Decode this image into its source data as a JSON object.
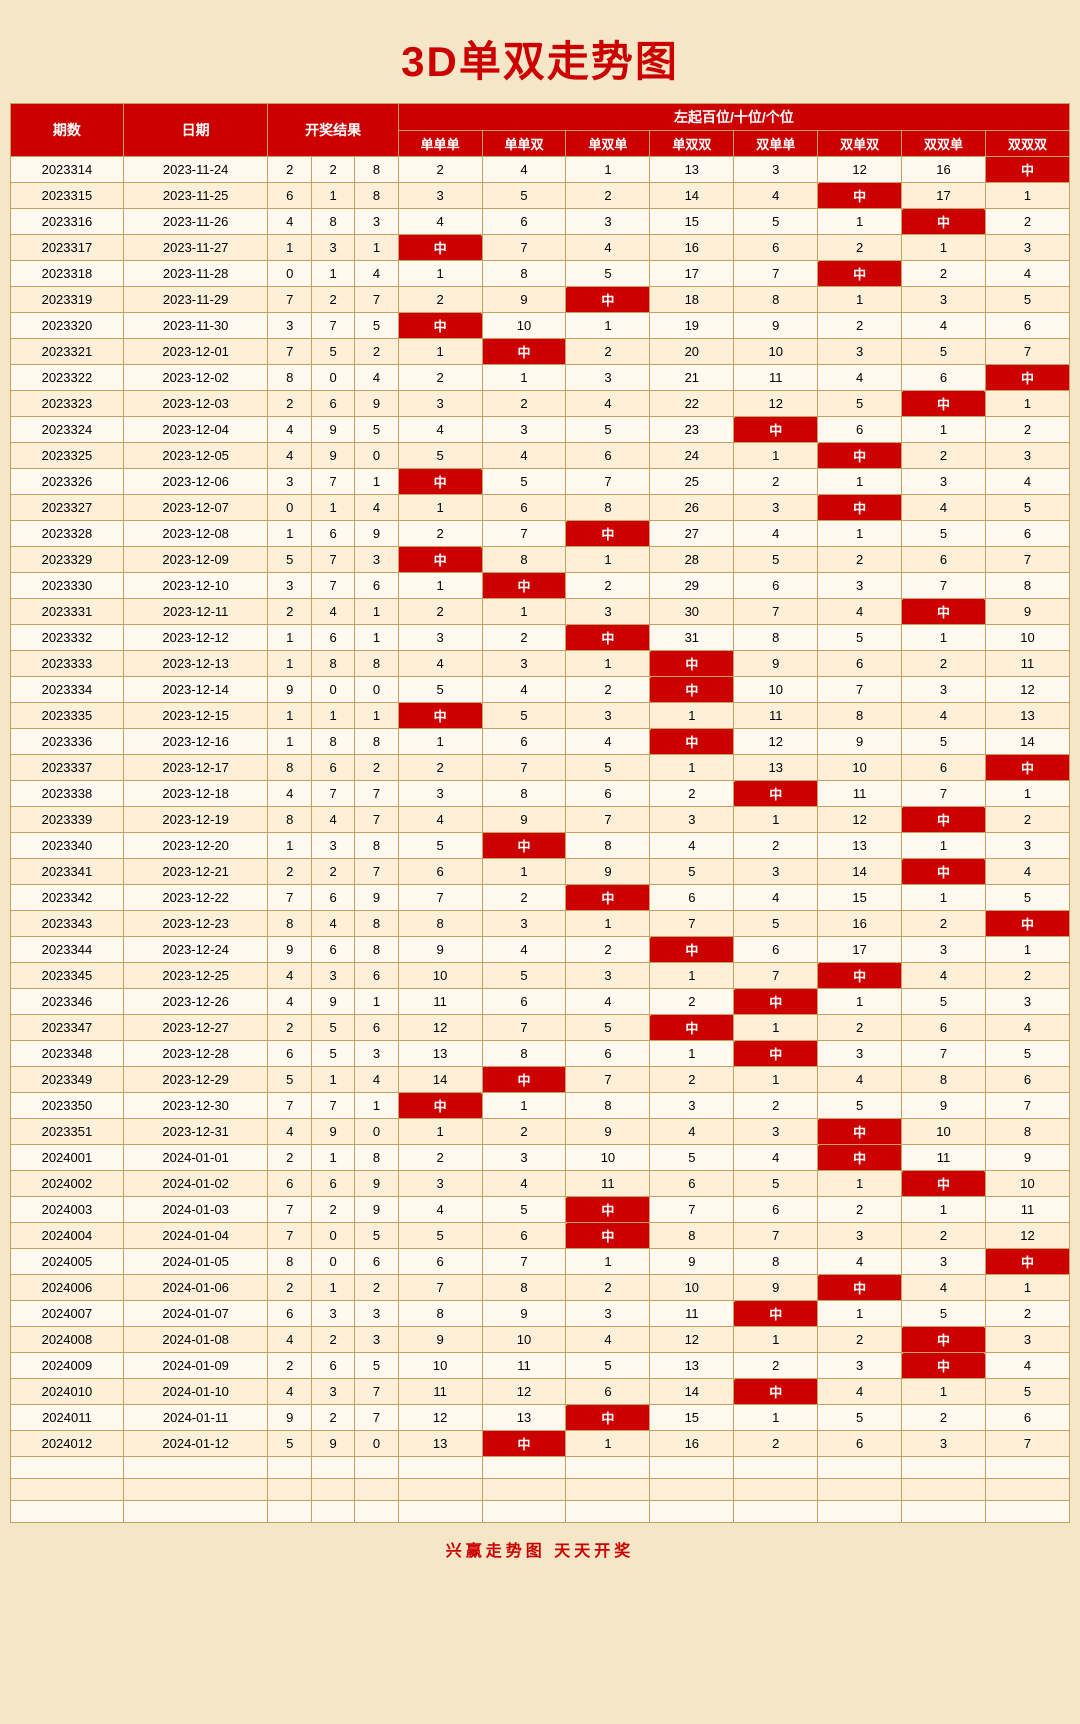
{
  "title": "3D单双走势图",
  "footer": "兴赢走势图   天天开奖",
  "headers": {
    "qishu": "期数",
    "date": "日期",
    "result": "开奖结果",
    "top_label": "左起百位/十位/个位",
    "cols": [
      "单单单",
      "单单双",
      "单双单",
      "单双双",
      "双单单",
      "双单双",
      "双双单",
      "双双双"
    ]
  },
  "rows": [
    {
      "id": "2023314",
      "date": "2023-11-24",
      "r": [
        2,
        2,
        8
      ],
      "vals": [
        2,
        4,
        1,
        13,
        3,
        12,
        16,
        "中"
      ]
    },
    {
      "id": "2023315",
      "date": "2023-11-25",
      "r": [
        6,
        1,
        8
      ],
      "vals": [
        3,
        5,
        2,
        14,
        4,
        "中",
        17,
        1
      ]
    },
    {
      "id": "2023316",
      "date": "2023-11-26",
      "r": [
        4,
        8,
        3
      ],
      "vals": [
        4,
        6,
        3,
        15,
        5,
        1,
        "中",
        2
      ]
    },
    {
      "id": "2023317",
      "date": "2023-11-27",
      "r": [
        1,
        3,
        1
      ],
      "vals": [
        "中",
        7,
        4,
        16,
        6,
        2,
        1,
        3
      ]
    },
    {
      "id": "2023318",
      "date": "2023-11-28",
      "r": [
        0,
        1,
        4
      ],
      "vals": [
        1,
        8,
        5,
        17,
        7,
        "中",
        2,
        4
      ]
    },
    {
      "id": "2023319",
      "date": "2023-11-29",
      "r": [
        7,
        2,
        7
      ],
      "vals": [
        2,
        9,
        "中",
        18,
        8,
        1,
        3,
        5
      ]
    },
    {
      "id": "2023320",
      "date": "2023-11-30",
      "r": [
        3,
        7,
        5
      ],
      "vals": [
        "中",
        10,
        1,
        19,
        9,
        2,
        4,
        6
      ]
    },
    {
      "id": "2023321",
      "date": "2023-12-01",
      "r": [
        7,
        5,
        2
      ],
      "vals": [
        1,
        "中",
        2,
        20,
        10,
        3,
        5,
        7
      ]
    },
    {
      "id": "2023322",
      "date": "2023-12-02",
      "r": [
        8,
        0,
        4
      ],
      "vals": [
        2,
        1,
        3,
        21,
        11,
        4,
        6,
        "中"
      ]
    },
    {
      "id": "2023323",
      "date": "2023-12-03",
      "r": [
        2,
        6,
        9
      ],
      "vals": [
        3,
        2,
        4,
        22,
        12,
        5,
        "中",
        1
      ]
    },
    {
      "id": "2023324",
      "date": "2023-12-04",
      "r": [
        4,
        9,
        5
      ],
      "vals": [
        4,
        3,
        5,
        23,
        "中",
        6,
        1,
        2
      ]
    },
    {
      "id": "2023325",
      "date": "2023-12-05",
      "r": [
        4,
        9,
        0
      ],
      "vals": [
        5,
        4,
        6,
        24,
        1,
        "中",
        2,
        3
      ]
    },
    {
      "id": "2023326",
      "date": "2023-12-06",
      "r": [
        3,
        7,
        1
      ],
      "vals": [
        "中",
        5,
        7,
        25,
        2,
        1,
        3,
        4
      ]
    },
    {
      "id": "2023327",
      "date": "2023-12-07",
      "r": [
        0,
        1,
        4
      ],
      "vals": [
        1,
        6,
        8,
        26,
        3,
        "中",
        4,
        5
      ]
    },
    {
      "id": "2023328",
      "date": "2023-12-08",
      "r": [
        1,
        6,
        9
      ],
      "vals": [
        2,
        7,
        "中",
        27,
        4,
        1,
        5,
        6
      ]
    },
    {
      "id": "2023329",
      "date": "2023-12-09",
      "r": [
        5,
        7,
        3
      ],
      "vals": [
        "中",
        8,
        1,
        28,
        5,
        2,
        6,
        7
      ]
    },
    {
      "id": "2023330",
      "date": "2023-12-10",
      "r": [
        3,
        7,
        6
      ],
      "vals": [
        1,
        "中",
        2,
        29,
        6,
        3,
        7,
        8
      ]
    },
    {
      "id": "2023331",
      "date": "2023-12-11",
      "r": [
        2,
        4,
        1
      ],
      "vals": [
        2,
        1,
        3,
        30,
        7,
        4,
        "中",
        9
      ]
    },
    {
      "id": "2023332",
      "date": "2023-12-12",
      "r": [
        1,
        6,
        1
      ],
      "vals": [
        3,
        2,
        "中",
        31,
        8,
        5,
        1,
        10
      ]
    },
    {
      "id": "2023333",
      "date": "2023-12-13",
      "r": [
        1,
        8,
        8
      ],
      "vals": [
        4,
        3,
        1,
        "中",
        9,
        6,
        2,
        11
      ]
    },
    {
      "id": "2023334",
      "date": "2023-12-14",
      "r": [
        9,
        0,
        0
      ],
      "vals": [
        5,
        4,
        2,
        "中",
        10,
        7,
        3,
        12
      ]
    },
    {
      "id": "2023335",
      "date": "2023-12-15",
      "r": [
        1,
        1,
        1
      ],
      "vals": [
        "中",
        5,
        3,
        1,
        11,
        8,
        4,
        13
      ]
    },
    {
      "id": "2023336",
      "date": "2023-12-16",
      "r": [
        1,
        8,
        8
      ],
      "vals": [
        1,
        6,
        4,
        "中",
        12,
        9,
        5,
        14
      ]
    },
    {
      "id": "2023337",
      "date": "2023-12-17",
      "r": [
        8,
        6,
        2
      ],
      "vals": [
        2,
        7,
        5,
        1,
        13,
        10,
        6,
        "中"
      ]
    },
    {
      "id": "2023338",
      "date": "2023-12-18",
      "r": [
        4,
        7,
        7
      ],
      "vals": [
        3,
        8,
        6,
        2,
        "中",
        11,
        7,
        1
      ]
    },
    {
      "id": "2023339",
      "date": "2023-12-19",
      "r": [
        8,
        4,
        7
      ],
      "vals": [
        4,
        9,
        7,
        3,
        1,
        12,
        "中",
        2
      ]
    },
    {
      "id": "2023340",
      "date": "2023-12-20",
      "r": [
        1,
        3,
        8
      ],
      "vals": [
        5,
        "中",
        8,
        4,
        2,
        13,
        1,
        3
      ]
    },
    {
      "id": "2023341",
      "date": "2023-12-21",
      "r": [
        2,
        2,
        7
      ],
      "vals": [
        6,
        1,
        9,
        5,
        3,
        14,
        "中",
        4
      ]
    },
    {
      "id": "2023342",
      "date": "2023-12-22",
      "r": [
        7,
        6,
        9
      ],
      "vals": [
        7,
        2,
        "中",
        6,
        4,
        15,
        1,
        5
      ]
    },
    {
      "id": "2023343",
      "date": "2023-12-23",
      "r": [
        8,
        4,
        8
      ],
      "vals": [
        8,
        3,
        1,
        7,
        5,
        16,
        2,
        "中"
      ]
    },
    {
      "id": "2023344",
      "date": "2023-12-24",
      "r": [
        9,
        6,
        8
      ],
      "vals": [
        9,
        4,
        2,
        "中",
        6,
        17,
        3,
        1
      ]
    },
    {
      "id": "2023345",
      "date": "2023-12-25",
      "r": [
        4,
        3,
        6
      ],
      "vals": [
        10,
        5,
        3,
        1,
        7,
        "中",
        4,
        2
      ]
    },
    {
      "id": "2023346",
      "date": "2023-12-26",
      "r": [
        4,
        9,
        1
      ],
      "vals": [
        11,
        6,
        4,
        2,
        "中",
        1,
        5,
        3
      ]
    },
    {
      "id": "2023347",
      "date": "2023-12-27",
      "r": [
        2,
        5,
        6
      ],
      "vals": [
        12,
        7,
        5,
        "中",
        1,
        2,
        6,
        4
      ]
    },
    {
      "id": "2023348",
      "date": "2023-12-28",
      "r": [
        6,
        5,
        3
      ],
      "vals": [
        13,
        8,
        6,
        1,
        "中",
        3,
        7,
        5
      ]
    },
    {
      "id": "2023349",
      "date": "2023-12-29",
      "r": [
        5,
        1,
        4
      ],
      "vals": [
        14,
        "中",
        7,
        2,
        1,
        4,
        8,
        6
      ]
    },
    {
      "id": "2023350",
      "date": "2023-12-30",
      "r": [
        7,
        7,
        1
      ],
      "vals": [
        "中",
        1,
        8,
        3,
        2,
        5,
        9,
        7
      ]
    },
    {
      "id": "2023351",
      "date": "2023-12-31",
      "r": [
        4,
        9,
        0
      ],
      "vals": [
        1,
        2,
        9,
        4,
        3,
        "中",
        10,
        8
      ]
    },
    {
      "id": "2024001",
      "date": "2024-01-01",
      "r": [
        2,
        1,
        8
      ],
      "vals": [
        2,
        3,
        10,
        5,
        4,
        "中",
        11,
        9
      ]
    },
    {
      "id": "2024002",
      "date": "2024-01-02",
      "r": [
        6,
        6,
        9
      ],
      "vals": [
        3,
        4,
        11,
        6,
        5,
        1,
        "中",
        10
      ]
    },
    {
      "id": "2024003",
      "date": "2024-01-03",
      "r": [
        7,
        2,
        9
      ],
      "vals": [
        4,
        5,
        "中",
        7,
        6,
        2,
        1,
        11
      ]
    },
    {
      "id": "2024004",
      "date": "2024-01-04",
      "r": [
        7,
        0,
        5
      ],
      "vals": [
        5,
        6,
        "中",
        8,
        7,
        3,
        2,
        12
      ]
    },
    {
      "id": "2024005",
      "date": "2024-01-05",
      "r": [
        8,
        0,
        6
      ],
      "vals": [
        6,
        7,
        1,
        9,
        8,
        4,
        3,
        "中"
      ]
    },
    {
      "id": "2024006",
      "date": "2024-01-06",
      "r": [
        2,
        1,
        2
      ],
      "vals": [
        7,
        8,
        2,
        10,
        9,
        "中",
        4,
        1
      ]
    },
    {
      "id": "2024007",
      "date": "2024-01-07",
      "r": [
        6,
        3,
        3
      ],
      "vals": [
        8,
        9,
        3,
        11,
        "中",
        1,
        5,
        2
      ]
    },
    {
      "id": "2024008",
      "date": "2024-01-08",
      "r": [
        4,
        2,
        3
      ],
      "vals": [
        9,
        10,
        4,
        12,
        1,
        2,
        "中",
        3
      ]
    },
    {
      "id": "2024009",
      "date": "2024-01-09",
      "r": [
        2,
        6,
        5
      ],
      "vals": [
        10,
        11,
        5,
        13,
        2,
        3,
        "中",
        4
      ]
    },
    {
      "id": "2024010",
      "date": "2024-01-10",
      "r": [
        4,
        3,
        7
      ],
      "vals": [
        11,
        12,
        6,
        14,
        "中",
        4,
        1,
        5
      ]
    },
    {
      "id": "2024011",
      "date": "2024-01-11",
      "r": [
        9,
        2,
        7
      ],
      "vals": [
        12,
        13,
        "中",
        15,
        1,
        5,
        2,
        6
      ]
    },
    {
      "id": "2024012",
      "date": "2024-01-12",
      "r": [
        5,
        9,
        0
      ],
      "vals": [
        13,
        "中",
        1,
        16,
        2,
        6,
        3,
        7
      ]
    }
  ]
}
